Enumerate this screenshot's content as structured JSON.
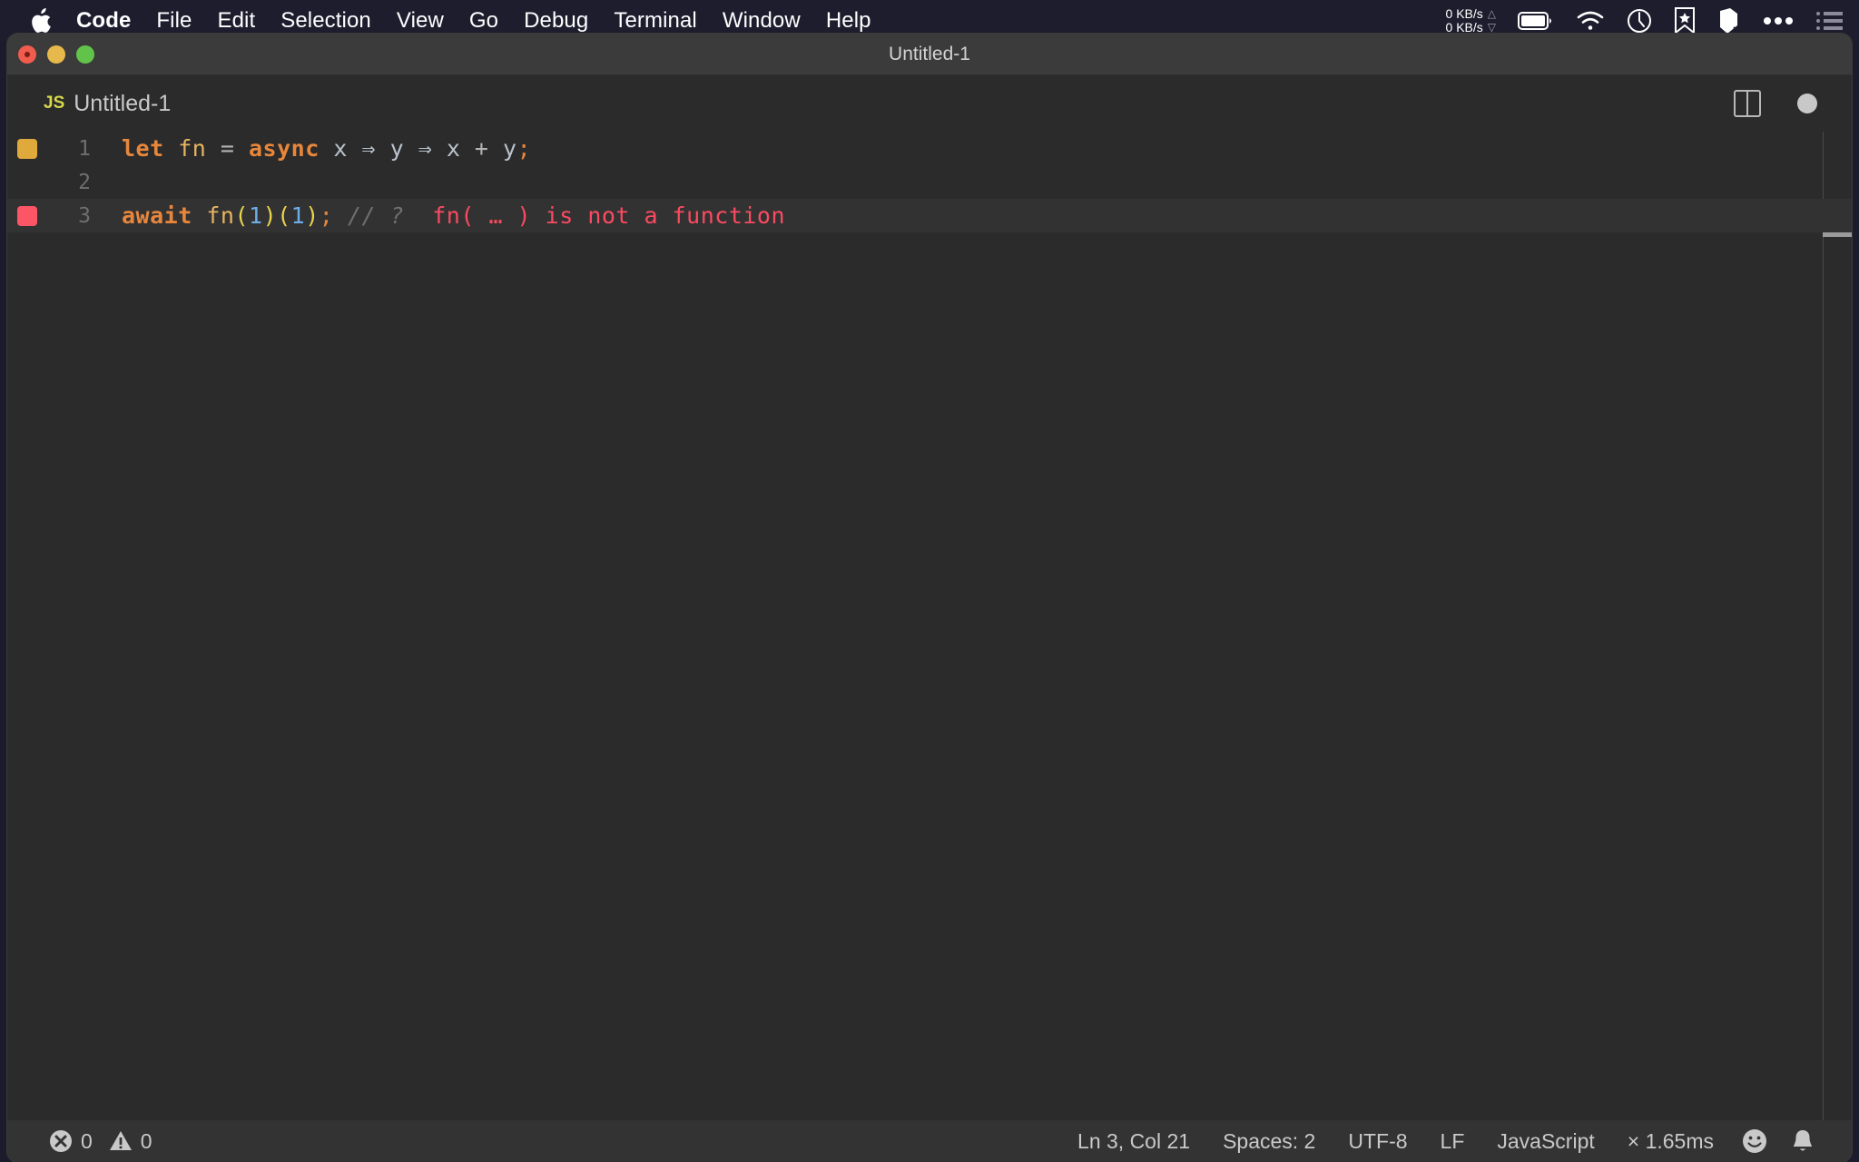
{
  "menubar": {
    "apple_icon": "apple-logo-icon",
    "items": [
      "Code",
      "File",
      "Edit",
      "Selection",
      "View",
      "Go",
      "Debug",
      "Terminal",
      "Window",
      "Help"
    ],
    "tray": {
      "net_up": "0 KB/s",
      "net_down": "0 KB/s",
      "up_triangle": "△",
      "down_triangle": "▽",
      "icons": [
        "battery-icon",
        "wifi-icon",
        "clock-icon",
        "bookmark-star-icon",
        "shield-icon",
        "ellipsis-icon",
        "list-icon"
      ]
    }
  },
  "window": {
    "title": "Untitled-1",
    "traffic_lights": [
      "close-button",
      "minimize-button",
      "zoom-button"
    ]
  },
  "tab": {
    "file_type_badge": "JS",
    "label": "Untitled-1",
    "split_editor_icon": "split-editor-icon",
    "dirty_indicator": "unsaved-dot-icon"
  },
  "editor": {
    "lines": [
      {
        "number": "1",
        "marker": "warn",
        "active": false,
        "tokens": [
          {
            "cls": "kw",
            "t": "let"
          },
          {
            "cls": "op",
            "t": " "
          },
          {
            "cls": "fnid",
            "t": "fn"
          },
          {
            "cls": "op",
            "t": " = "
          },
          {
            "cls": "kw",
            "t": "async"
          },
          {
            "cls": "op",
            "t": " "
          },
          {
            "cls": "ident",
            "t": "x"
          },
          {
            "cls": "op",
            "t": " "
          },
          {
            "cls": "arrow",
            "t": "⇒"
          },
          {
            "cls": "op",
            "t": " "
          },
          {
            "cls": "ident",
            "t": "y"
          },
          {
            "cls": "op",
            "t": " "
          },
          {
            "cls": "arrow",
            "t": "⇒"
          },
          {
            "cls": "op",
            "t": " "
          },
          {
            "cls": "ident",
            "t": "x"
          },
          {
            "cls": "op",
            "t": " + "
          },
          {
            "cls": "ident",
            "t": "y"
          },
          {
            "cls": "semi",
            "t": ";"
          }
        ]
      },
      {
        "number": "2",
        "marker": "none",
        "active": false,
        "tokens": []
      },
      {
        "number": "3",
        "marker": "err",
        "active": true,
        "tokens": [
          {
            "cls": "kw",
            "t": "await"
          },
          {
            "cls": "op",
            "t": " "
          },
          {
            "cls": "fnid",
            "t": "fn"
          },
          {
            "cls": "paren",
            "t": "("
          },
          {
            "cls": "num",
            "t": "1"
          },
          {
            "cls": "paren",
            "t": ")("
          },
          {
            "cls": "num",
            "t": "1"
          },
          {
            "cls": "paren",
            "t": ")"
          },
          {
            "cls": "semi",
            "t": ";"
          },
          {
            "cls": "op",
            "t": " "
          },
          {
            "cls": "cmt",
            "t": "// ?"
          },
          {
            "cls": "op",
            "t": "  "
          },
          {
            "cls": "errtext",
            "t": "fn( … ) is not a function"
          }
        ]
      }
    ],
    "raw_text": [
      "let fn = async x => y => x + y;",
      "",
      "await fn(1)(1); // ?  fn( … ) is not a function"
    ]
  },
  "statusbar": {
    "error_icon": "error-circle-icon",
    "error_count": "0",
    "warning_icon": "warning-triangle-icon",
    "warning_count": "0",
    "cursor_position": "Ln 3, Col 21",
    "indentation": "Spaces: 2",
    "encoding": "UTF-8",
    "eol": "LF",
    "language": "JavaScript",
    "run_time": "× 1.65ms",
    "feedback_icon": "smiley-icon",
    "notifications_icon": "bell-icon"
  },
  "colors": {
    "menubar_bg": "#1d1d2e",
    "titlebar_bg": "#3b3b3b",
    "editor_bg": "#2b2b2b",
    "active_line_bg": "#323232",
    "statusbar_bg": "#333333",
    "keyword": "#e8873b",
    "function": "#e8b461",
    "number": "#6eaee8",
    "paren": "#e8d44d",
    "error": "#fb4a61",
    "comment": "#6f6f6f",
    "warn_marker": "#dfa93c",
    "err_marker": "#fb5566"
  }
}
